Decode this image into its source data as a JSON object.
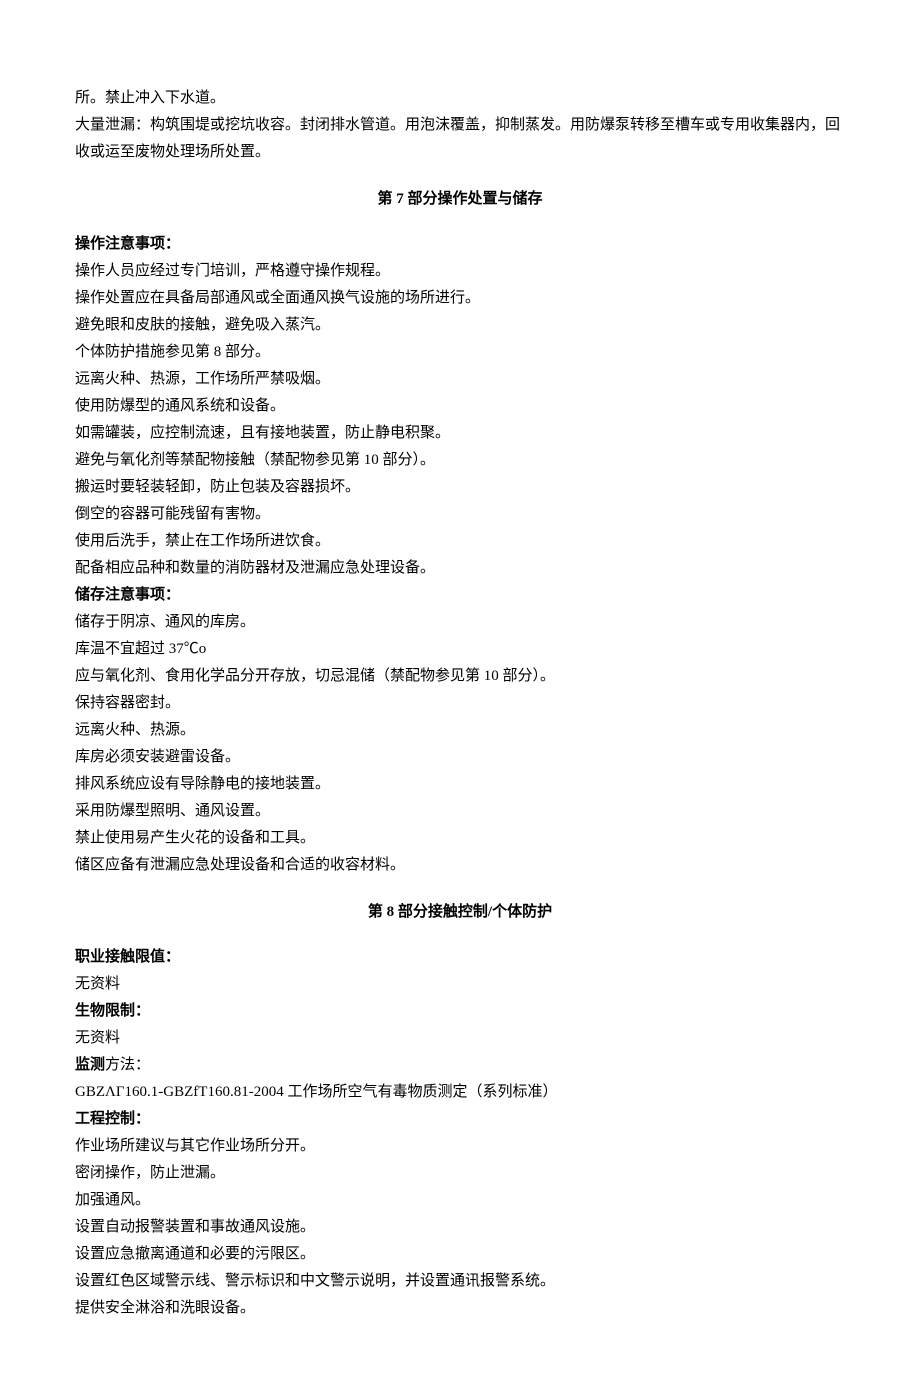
{
  "intro": {
    "p1": "所。禁止冲入下水道。",
    "p2": "大量泄漏：构筑围堤或挖坑收容。封闭排水管道。用泡沫覆盖，抑制蒸发。用防爆泵转移至槽车或专用收集器内，回收或运至废物处理场所处置。"
  },
  "section7": {
    "heading": "第 7 部分操作处置与储存",
    "ops_label": "操作注意事项：",
    "ops_items": [
      "操作人员应经过专门培训，严格遵守操作规程。",
      "操作处置应在具备局部通风或全面通风换气设施的场所进行。",
      "避免眼和皮肤的接触，避免吸入蒸汽。",
      "个体防护措施参见第 8 部分。",
      "远离火种、热源，工作场所严禁吸烟。",
      "使用防爆型的通风系统和设备。",
      "如需罐装，应控制流速，且有接地装置，防止静电积聚。",
      "避免与氧化剂等禁配物接触（禁配物参见第 10 部分）。",
      "搬运时要轻装轻卸，防止包装及容器损坏。",
      "倒空的容器可能残留有害物。",
      "使用后洗手，禁止在工作场所进饮食。",
      "配备相应品种和数量的消防器材及泄漏应急处理设备。"
    ],
    "store_label": "储存注意事项：",
    "store_items": [
      "储存于阴凉、通风的库房。",
      "库温不宜超过 37℃o",
      "应与氧化剂、食用化学品分开存放，切忌混储（禁配物参见第 10 部分）。",
      "保持容器密封。",
      "远离火种、热源。",
      "库房必须安装避雷设备。",
      "排风系统应设有导除静电的接地装置。",
      "采用防爆型照明、通风设置。",
      "禁止使用易产生火花的设备和工具。",
      "储区应备有泄漏应急处理设备和合适的收容材料。"
    ]
  },
  "section8": {
    "heading": "第 8 部分接触控制/个体防护",
    "occ_label": "职业接触限值：",
    "occ_value": "无资料",
    "bio_label": "生物限制：",
    "bio_value": "无资料",
    "mon_prefix": "监测",
    "mon_suffix": "方法：",
    "mon_value": "GBZΛΓ160.1-GBZfT160.81-2004 工作场所空气有毒物质测定（系列标准）",
    "eng_label": "工程控制：",
    "eng_items": [
      "作业场所建议与其它作业场所分开。",
      "密闭操作，防止泄漏。",
      "加强通风。",
      "设置自动报警装置和事故通风设施。",
      "设置应急撤离通道和必要的污限区。",
      "设置红色区域警示线、警示标识和中文警示说明，并设置通讯报警系统。",
      "提供安全淋浴和洗眼设备。"
    ]
  }
}
